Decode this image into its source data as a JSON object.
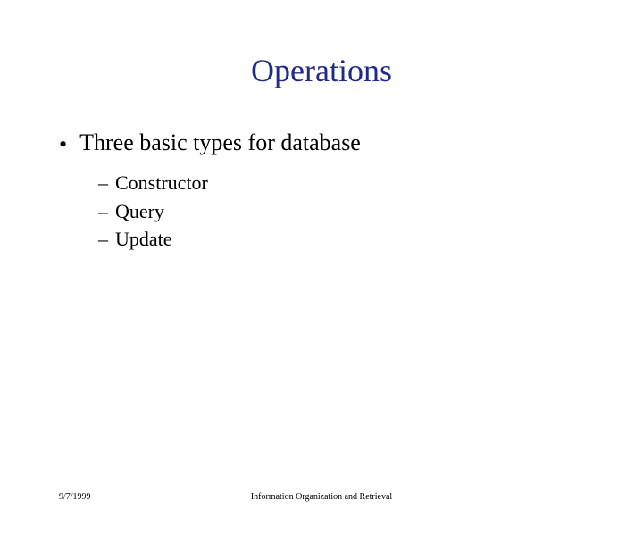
{
  "slide": {
    "title": "Operations",
    "bullet": "Three basic types for database",
    "sub_items": {
      "0": "Constructor",
      "1": "Query",
      "2": "Update"
    }
  },
  "footer": {
    "date": "9/7/1999",
    "center_text": "Information Organization and Retrieval"
  }
}
